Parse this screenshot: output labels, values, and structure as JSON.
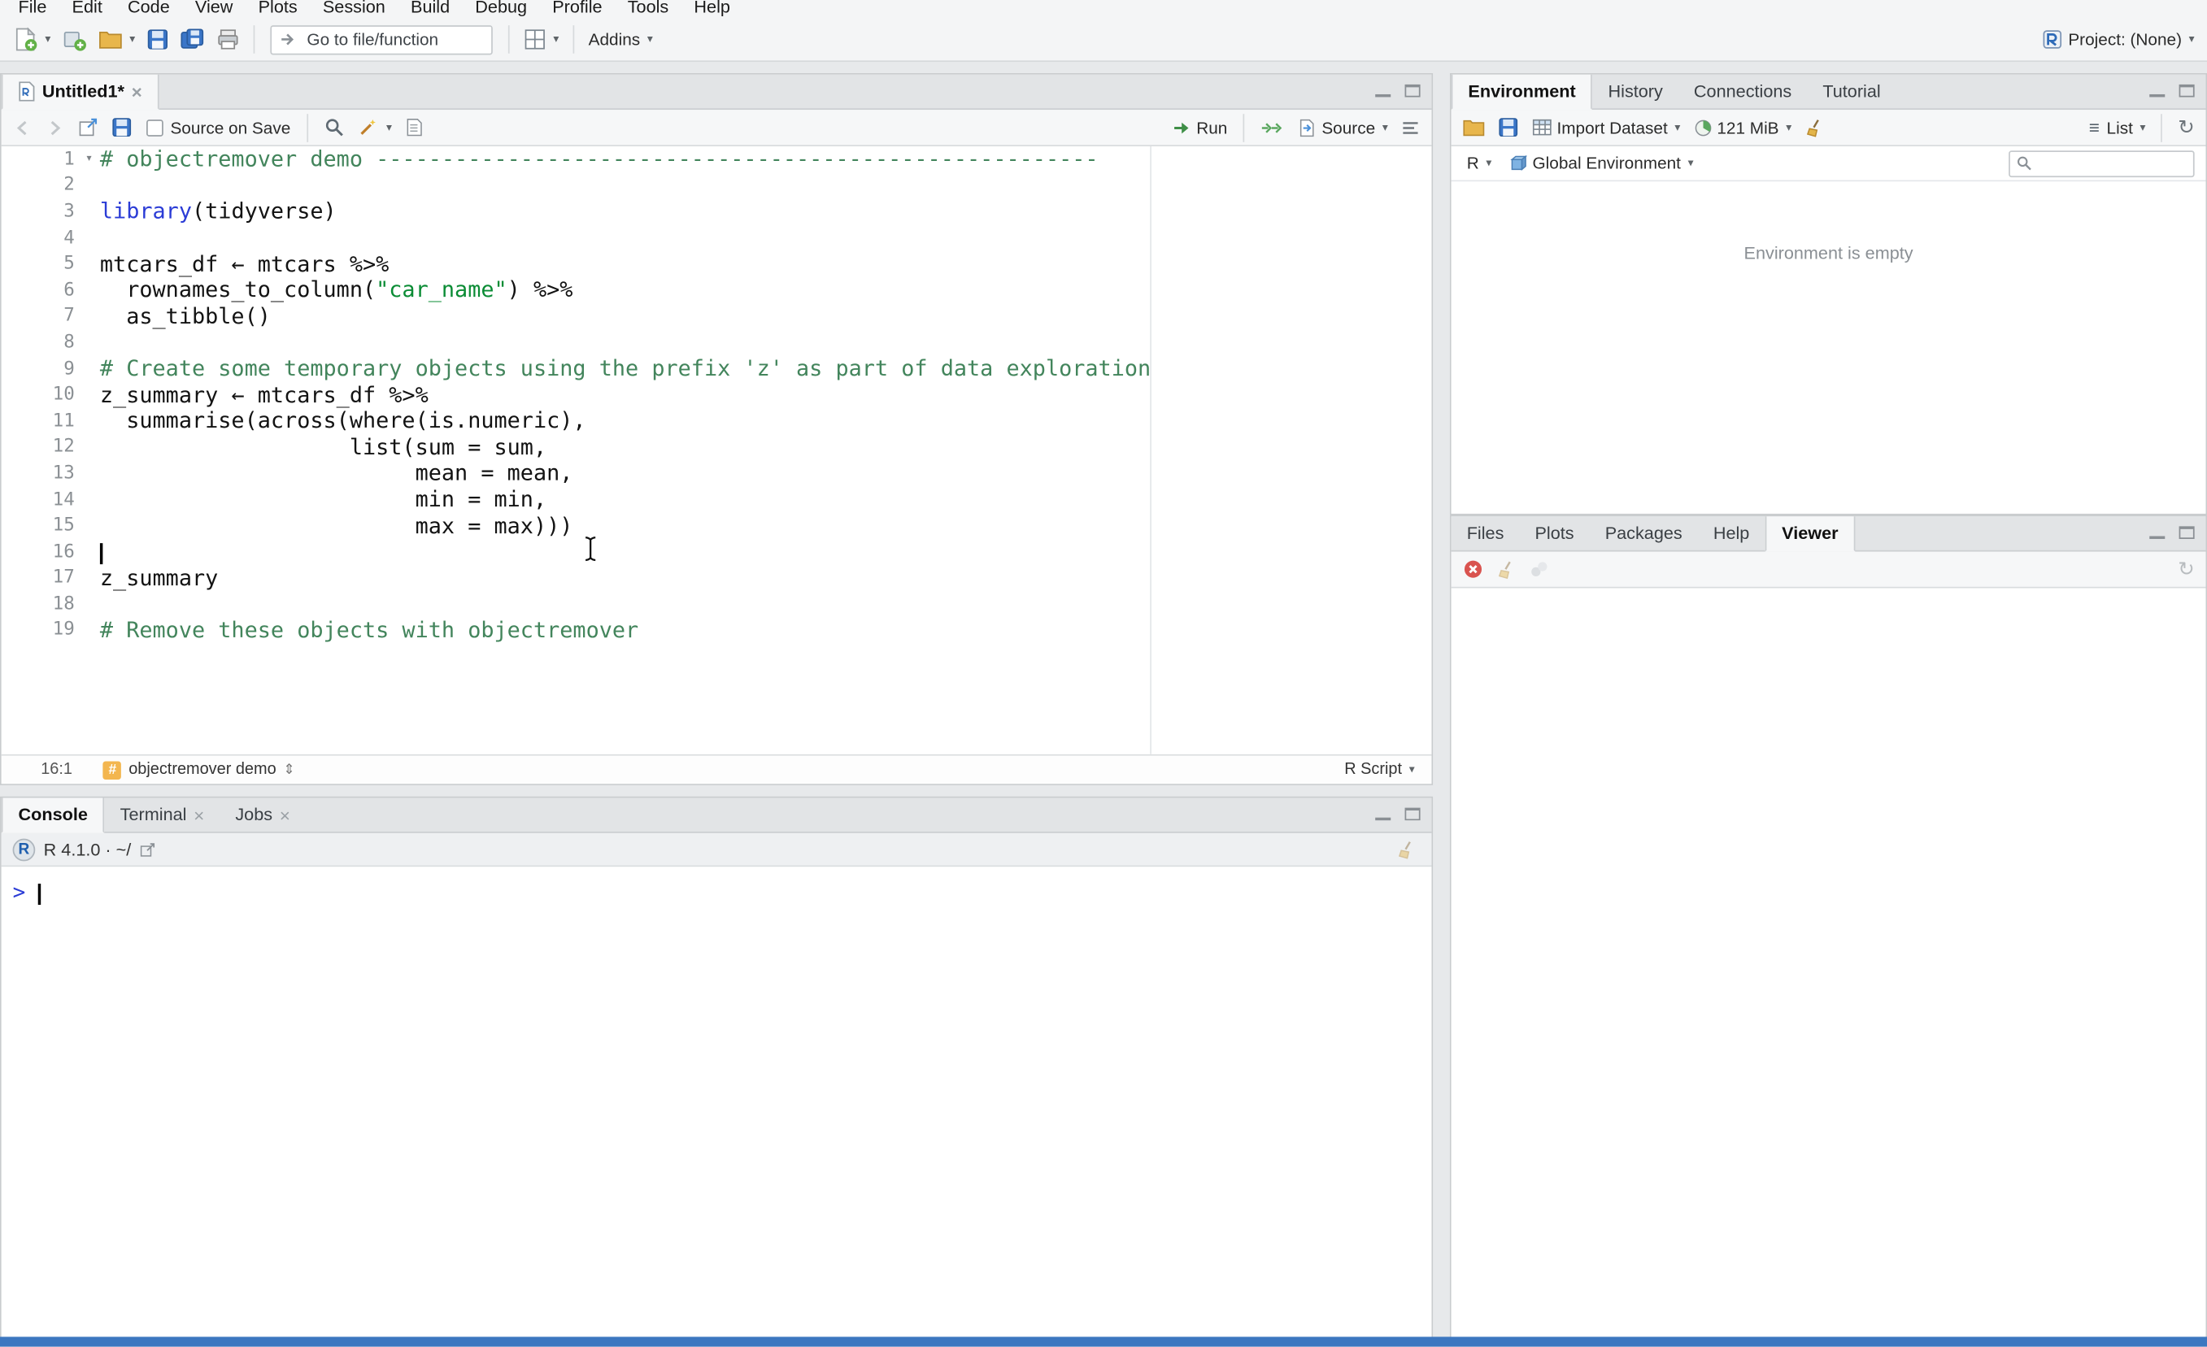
{
  "colors": {
    "comment": "#43855c",
    "string": "#0b8c35",
    "keyword": "#2b3cd6",
    "console_prompt": "#2b3cd6",
    "run_green": "#3e8e46",
    "save_blue": "#3b76c8",
    "clear_red": "#d9534f",
    "taskbar_blue": "#3c77c0"
  },
  "icons": {
    "chevron_down": "▾",
    "close_glyph": "×",
    "swap_vertical": "⇕",
    "list_glyph": "≡",
    "refresh_glyph": "↻",
    "hash_glyph": "#",
    "r_logo": "R"
  },
  "menubar": {
    "items": [
      "File",
      "Edit",
      "Code",
      "View",
      "Plots",
      "Session",
      "Build",
      "Debug",
      "Profile",
      "Tools",
      "Help"
    ]
  },
  "toolbar": {
    "goto_placeholder": "Go to file/function",
    "addins_label": "Addins",
    "project_label": "Project: (None)"
  },
  "source_pane": {
    "tab_title": "Untitled1*",
    "toolbar": {
      "source_on_save_label": "Source on Save",
      "run_label": "Run",
      "source_label": "Source"
    },
    "status": {
      "cursor_position": "16:1",
      "section_label": "objectremover demo",
      "file_type_label": "R Script"
    },
    "code": {
      "lines": [
        {
          "n": 1,
          "fold": true,
          "tokens": [
            {
              "t": "# objectremover demo -------------------------------------------------------",
              "c": "comment"
            }
          ]
        },
        {
          "n": 2,
          "tokens": []
        },
        {
          "n": 3,
          "tokens": [
            {
              "t": "library",
              "c": "keyword"
            },
            {
              "t": "(tidyverse)"
            }
          ]
        },
        {
          "n": 4,
          "tokens": []
        },
        {
          "n": 5,
          "tokens": [
            {
              "t": "mtcars_df ← mtcars %>%"
            }
          ]
        },
        {
          "n": 6,
          "tokens": [
            {
              "t": "  rownames_to_column("
            },
            {
              "t": "\"car_name\"",
              "c": "string"
            },
            {
              "t": ") %>%"
            }
          ]
        },
        {
          "n": 7,
          "tokens": [
            {
              "t": "  as_tibble()"
            }
          ]
        },
        {
          "n": 8,
          "tokens": []
        },
        {
          "n": 9,
          "tokens": [
            {
              "t": "# Create some temporary objects using the prefix 'z' as part of data exploration",
              "c": "comment"
            }
          ]
        },
        {
          "n": 10,
          "tokens": [
            {
              "t": "z_summary ← mtcars_df %>%"
            }
          ]
        },
        {
          "n": 11,
          "tokens": [
            {
              "t": "  summarise(across(where(is.numeric),"
            }
          ]
        },
        {
          "n": 12,
          "tokens": [
            {
              "t": "                   list(sum = sum,"
            }
          ]
        },
        {
          "n": 13,
          "tokens": [
            {
              "t": "                        mean = mean,"
            }
          ]
        },
        {
          "n": 14,
          "tokens": [
            {
              "t": "                        min = min,"
            }
          ]
        },
        {
          "n": 15,
          "tokens": [
            {
              "t": "                        max = max)))"
            }
          ]
        },
        {
          "n": 16,
          "caret": true,
          "tokens": []
        },
        {
          "n": 17,
          "tokens": [
            {
              "t": "z_summary"
            }
          ]
        },
        {
          "n": 18,
          "tokens": []
        },
        {
          "n": 19,
          "tokens": [
            {
              "t": "# Remove these objects with objectremover",
              "c": "comment"
            }
          ]
        }
      ]
    }
  },
  "console_pane": {
    "tabs": [
      {
        "label": "Console",
        "active": true,
        "closable": false
      },
      {
        "label": "Terminal",
        "active": false,
        "closable": true
      },
      {
        "label": "Jobs",
        "active": false,
        "closable": true
      }
    ],
    "header_text": "R 4.1.0 · ~/",
    "prompt": ">"
  },
  "environment_pane": {
    "tabs": [
      {
        "label": "Environment",
        "active": true
      },
      {
        "label": "History"
      },
      {
        "label": "Connections"
      },
      {
        "label": "Tutorial"
      }
    ],
    "toolbar": {
      "import_dataset_label": "Import Dataset",
      "memory_label": "121 MiB",
      "list_label": "List"
    },
    "scope_row": {
      "r_label": "R",
      "scope_label": "Global Environment"
    },
    "empty_message": "Environment is empty"
  },
  "viewer_pane": {
    "tabs": [
      {
        "label": "Files"
      },
      {
        "label": "Plots"
      },
      {
        "label": "Packages"
      },
      {
        "label": "Help"
      },
      {
        "label": "Viewer",
        "active": true
      }
    ]
  }
}
